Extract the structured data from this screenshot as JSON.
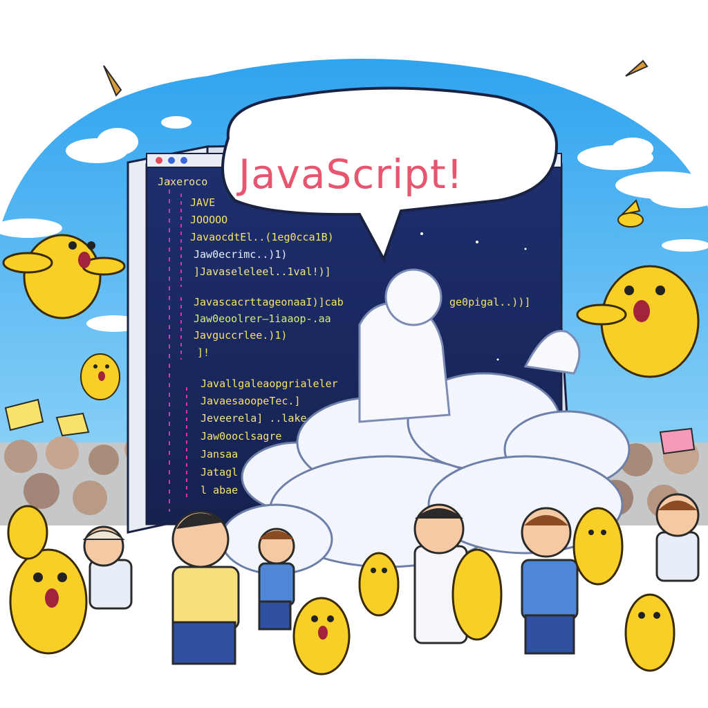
{
  "speech_bubble": {
    "text": "JavaScript!"
  },
  "editor": {
    "window_buttons": [
      "close",
      "minimize",
      "maximize"
    ],
    "lines": [
      "Jaxeroco",
      "JAVE",
      "JOOOOO",
      "JavaocdtEl..(1eg0cca1B)",
      "Jaw0ecrimc..)1)",
      "]Javaseleleel..1val!)]",
      "JavascacrttageonaaI)]cab",
      "Jaw0eoolrer—1iaaop-.aa",
      "Javguccrlee.)1)",
      "]!",
      "Javallgaleaopgrialeler",
      "JavaesaoopeTec.]",
      "Jeveerela] ..lake",
      "Jaw0ooclsagre",
      "Jansaa",
      "Jatagl",
      "l abae"
    ],
    "overflow_text": "ge0pigal..))]"
  },
  "colors": {
    "sky": "#4fb8f0",
    "editor_bg": "#1c2a63",
    "bubble_text": "#e8556e",
    "creature": "#f8cf27",
    "cloud": "#f2f6fc"
  }
}
